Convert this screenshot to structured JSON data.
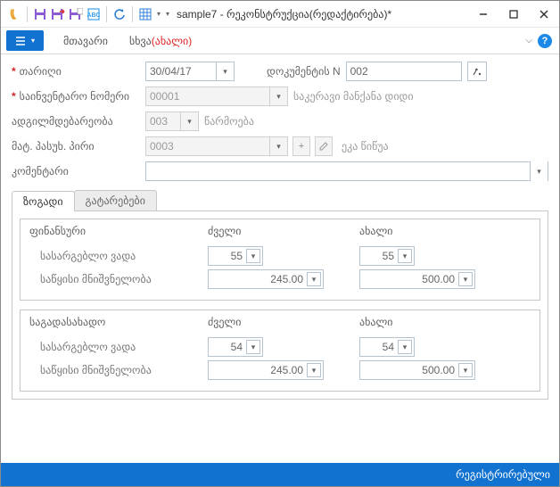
{
  "title": "sample7 - რეკონსტრუქცია(რედაქტირება)*",
  "menus": {
    "main": "მთავარი",
    "other": "სხვა",
    "new_suffix": "(ახალი)"
  },
  "labels": {
    "date": "თარიღი",
    "doc_n": "დოკუმენტის N",
    "inventory_number": "საინვენტარო ნომერი",
    "location": "ადგილმდებარეობა",
    "responsible_person": "მატ. პასუხ. პირი",
    "comment": "კომენტარი"
  },
  "values": {
    "date": "30/04/17",
    "doc_n": "002",
    "inventory_number": "00001",
    "inventory_desc": "საკერავი მანქანა დიდი",
    "location": "003",
    "location_desc": "წარმოება",
    "responsible": "0003",
    "responsible_desc": "ეკა წიწუა",
    "comment": ""
  },
  "tabs": {
    "general": "ზოგადი",
    "postings": "გატარებები"
  },
  "group_headers": {
    "old": "ძველი",
    "new": "ახალი"
  },
  "groups": {
    "financial": {
      "title": "ფინანსური",
      "useful_life_label": "სასარგებლო ვადა",
      "start_value_label": "საწყისი მნიშვნელობა",
      "old_useful": "55",
      "new_useful": "55",
      "old_start": "245.00",
      "new_start": "500.00"
    },
    "tax": {
      "title": "საგადასახადო",
      "useful_life_label": "სასარგებლო ვადა",
      "start_value_label": "საწყისი მნიშვნელობა",
      "old_useful": "54",
      "new_useful": "54",
      "old_start": "245.00",
      "new_start": "500.00"
    }
  },
  "statusbar": "რეგისტრირებული"
}
